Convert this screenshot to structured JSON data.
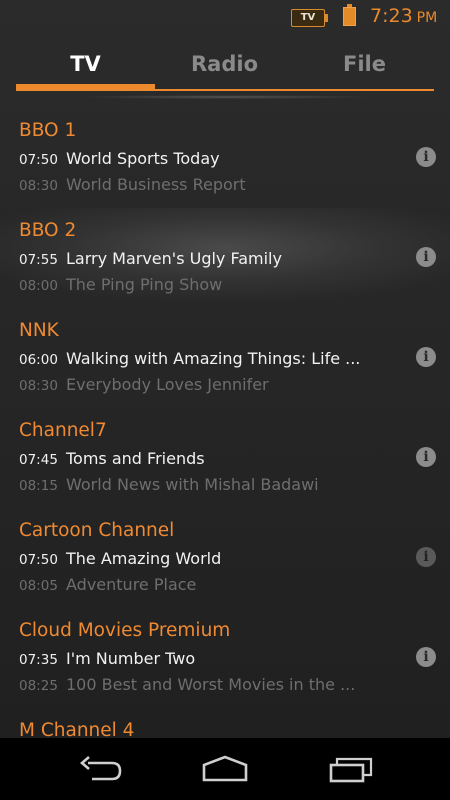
{
  "status_bar": {
    "tv_icon_label": "TV",
    "time": "7:23",
    "ampm": "PM",
    "accent_color": "#ec8a2d"
  },
  "tabs": [
    {
      "label": "TV",
      "active": true
    },
    {
      "label": "Radio",
      "active": false
    },
    {
      "label": "File",
      "active": false
    }
  ],
  "channels": [
    {
      "name": "BBO 1",
      "now": {
        "time": "07:50",
        "title": "World Sports Today"
      },
      "next": {
        "time": "08:30",
        "title": "World Business Report"
      }
    },
    {
      "name": "BBO 2",
      "now": {
        "time": "07:55",
        "title": "Larry Marven's Ugly Family"
      },
      "next": {
        "time": "08:00",
        "title": "The Ping Ping Show"
      }
    },
    {
      "name": "NNK",
      "now": {
        "time": "06:00",
        "title": "Walking with Amazing Things: Life ..."
      },
      "next": {
        "time": "08:30",
        "title": "Everybody Loves Jennifer"
      }
    },
    {
      "name": "Channel7",
      "now": {
        "time": "07:45",
        "title": "Toms and Friends"
      },
      "next": {
        "time": "08:15",
        "title": "World News with Mishal Badawi"
      }
    },
    {
      "name": "Cartoon Channel",
      "now": {
        "time": "07:50",
        "title": "The Amazing World"
      },
      "next": {
        "time": "08:05",
        "title": "Adventure Place"
      }
    },
    {
      "name": "Cloud Movies Premium",
      "now": {
        "time": "07:35",
        "title": "I'm Number Two"
      },
      "next": {
        "time": "08:25",
        "title": "100 Best and Worst Movies in the ..."
      }
    },
    {
      "name": "M Channel 4"
    }
  ],
  "info_icon": "info-icon",
  "nav_icons": [
    "back-icon",
    "home-icon",
    "recent-apps-icon"
  ]
}
